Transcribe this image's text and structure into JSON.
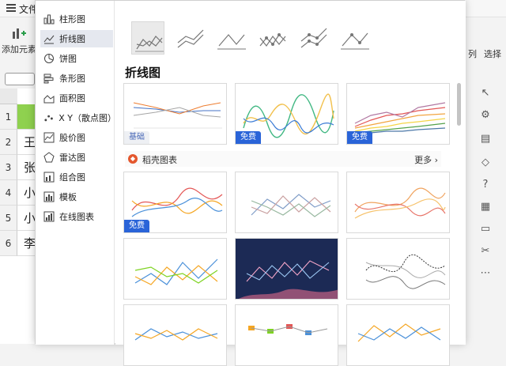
{
  "app": {
    "file_menu": "文件",
    "toolbar_left": "添加元素",
    "toolbar_right1": "列",
    "toolbar_right2": "选择",
    "rows": [
      {
        "num": "1",
        "text": ""
      },
      {
        "num": "2",
        "text": "王"
      },
      {
        "num": "3",
        "text": "张"
      },
      {
        "num": "4",
        "text": "小"
      },
      {
        "num": "5",
        "text": "小"
      },
      {
        "num": "6",
        "text": "李"
      }
    ]
  },
  "dialog": {
    "categories": [
      {
        "label": "柱形图",
        "icon": "column-chart-icon"
      },
      {
        "label": "折线图",
        "icon": "line-chart-icon"
      },
      {
        "label": "饼图",
        "icon": "pie-chart-icon"
      },
      {
        "label": "条形图",
        "icon": "bar-chart-icon"
      },
      {
        "label": "面积图",
        "icon": "area-chart-icon"
      },
      {
        "label": "X Y（散点图）",
        "icon": "scatter-chart-icon"
      },
      {
        "label": "股价图",
        "icon": "stock-chart-icon"
      },
      {
        "label": "雷达图",
        "icon": "radar-chart-icon"
      },
      {
        "label": "组合图",
        "icon": "combo-chart-icon"
      },
      {
        "label": "模板",
        "icon": "template-icon"
      },
      {
        "label": "在线图表",
        "icon": "online-chart-icon"
      }
    ],
    "active_category": "折线图",
    "section_title": "折线图",
    "daoke_title": "稻壳图表",
    "more_label": "更多",
    "badge_basic": "基础",
    "badge_free": "免费",
    "colors": {
      "accent_blue": "#2a64d8",
      "selected_green": "#8fd14f",
      "daoke_orange": "#e4572e",
      "dark_thumb": "#1c2a55"
    }
  }
}
